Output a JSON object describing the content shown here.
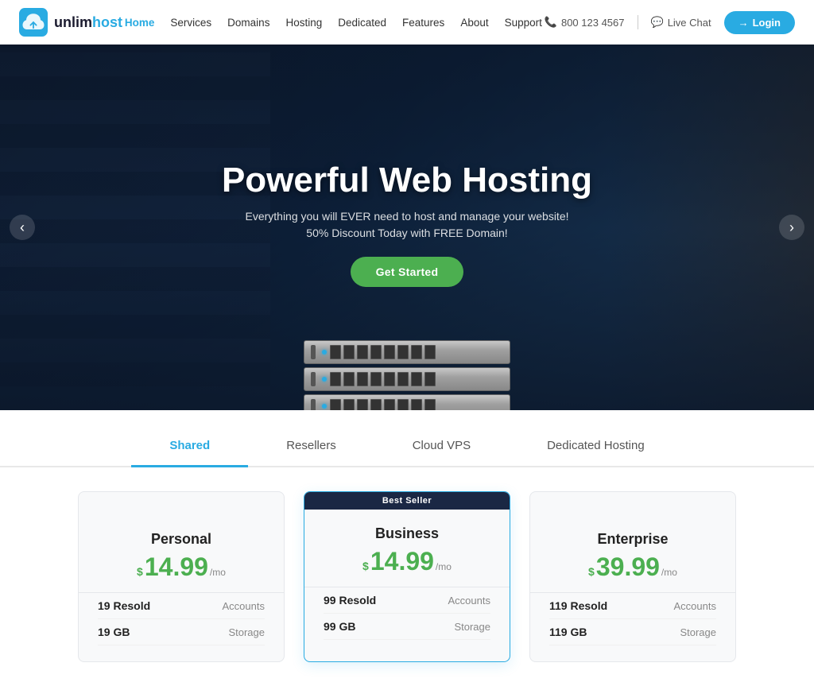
{
  "header": {
    "logo_text_start": "unlim",
    "logo_text_end": "host",
    "nav_items": [
      {
        "label": "Home",
        "active": true
      },
      {
        "label": "Services",
        "active": false
      },
      {
        "label": "Domains",
        "active": false
      },
      {
        "label": "Hosting",
        "active": false
      },
      {
        "label": "Dedicated",
        "active": false
      },
      {
        "label": "Features",
        "active": false
      },
      {
        "label": "About",
        "active": false
      },
      {
        "label": "Support",
        "active": false
      }
    ],
    "phone": "800 123 4567",
    "live_chat": "Live Chat",
    "login_label": "Login"
  },
  "hero": {
    "title": "Powerful Web Hosting",
    "subtitle": "Everything you will EVER need to host and manage your website!",
    "subtitle2": "50% Discount Today with FREE Domain!",
    "cta_label": "Get Started",
    "arrow_left": "‹",
    "arrow_right": "›"
  },
  "tabs": {
    "items": [
      {
        "label": "Shared",
        "active": true
      },
      {
        "label": "Resellers",
        "active": false
      },
      {
        "label": "Cloud VPS",
        "active": false
      },
      {
        "label": "Dedicated Hosting",
        "active": false
      }
    ]
  },
  "pricing": {
    "cards": [
      {
        "featured": false,
        "badge": null,
        "title": "Personal",
        "price": "14.99",
        "period": "/mo",
        "features": [
          {
            "value": "19 Resold",
            "label": "Accounts"
          },
          {
            "value": "19 GB",
            "label": "Storage"
          }
        ]
      },
      {
        "featured": true,
        "badge": "Best Seller",
        "title": "Business",
        "price": "14.99",
        "period": "/mo",
        "features": [
          {
            "value": "99 Resold",
            "label": "Accounts"
          },
          {
            "value": "99 GB",
            "label": "Storage"
          }
        ]
      },
      {
        "featured": false,
        "badge": null,
        "title": "Enterprise",
        "price": "39.99",
        "period": "/mo",
        "features": [
          {
            "value": "119 Resold",
            "label": "Accounts"
          },
          {
            "value": "119 GB",
            "label": "Storage"
          }
        ]
      }
    ]
  }
}
